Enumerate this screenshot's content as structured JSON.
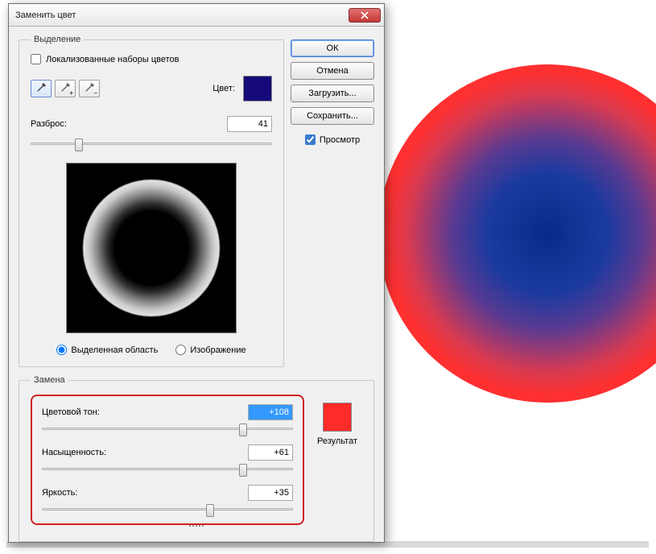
{
  "title": "Заменить цвет",
  "buttons": {
    "ok": "ОК",
    "cancel": "Отмена",
    "load": "Загрузить...",
    "save": "Сохранить..."
  },
  "preview_check": "Просмотр",
  "selection": {
    "legend": "Выделение",
    "localized": "Локализованные наборы цветов",
    "color_label": "Цвет:",
    "color_hex": "#160a7a",
    "spread_label": "Разброс:",
    "spread_value": "41",
    "radio_selection": "Выделенная область",
    "radio_image": "Изображение"
  },
  "replace": {
    "legend": "Замена",
    "hue_label": "Цветовой тон:",
    "hue_value": "+108",
    "sat_label": "Насыщенность:",
    "sat_value": "+61",
    "light_label": "Яркость:",
    "light_value": "+35",
    "result_label": "Результат",
    "result_hex": "#ff2a2a"
  }
}
